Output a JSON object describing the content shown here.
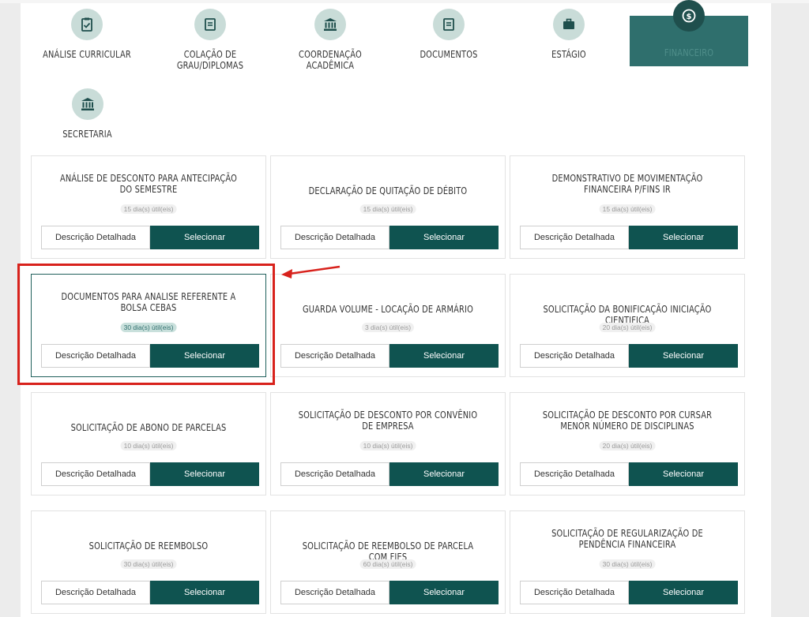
{
  "categories": [
    {
      "label": "ANÁLISE CURRICULAR",
      "icon": "clipboard-check-icon"
    },
    {
      "label": "COLAÇÃO DE\nGRAU/DIPLOMAS",
      "icon": "document-icon"
    },
    {
      "label": "COORDENAÇÃO\nACADÊMICA",
      "icon": "building-columns-icon"
    },
    {
      "label": "DOCUMENTOS",
      "icon": "document-icon"
    },
    {
      "label": "ESTÁGIO",
      "icon": "briefcase-icon"
    },
    {
      "label": "FINANCEIRO",
      "icon": "dollar-icon",
      "active": true
    },
    {
      "label": "SECRETARIA",
      "icon": "building-columns-icon"
    }
  ],
  "services": [
    {
      "title": "ANÁLISE DE DESCONTO PARA ANTECIPAÇÃO DO SEMESTRE",
      "deadline": "15 dia(s) útil(eis)"
    },
    {
      "title": "DECLARAÇÃO DE QUITAÇÃO DE DÉBITO",
      "deadline": "15 dia(s) útil(eis)"
    },
    {
      "title": "DEMONSTRATIVO DE MOVIMENTAÇÃO FINANCEIRA P/FINS IR",
      "deadline": "15 dia(s) útil(eis)"
    },
    {
      "title": "DOCUMENTOS PARA ANALISE REFERENTE A BOLSA CEBAS",
      "deadline": "30 dia(s) útil(eis)",
      "highlighted": true
    },
    {
      "title": "GUARDA VOLUME - LOCAÇÃO DE ARMÁRIO",
      "deadline": "3 dia(s) útil(eis)"
    },
    {
      "title": "SOLICITAÇÃO DA BONIFICAÇÃO INICIAÇÃO CIENTIFICA",
      "deadline": "20 dia(s) útil(eis)"
    },
    {
      "title": "SOLICITAÇÃO DE ABONO DE PARCELAS",
      "deadline": "10 dia(s) útil(eis)"
    },
    {
      "title": "SOLICITAÇÃO DE DESCONTO POR CONVÊNIO DE EMPRESA",
      "deadline": "10 dia(s) útil(eis)"
    },
    {
      "title": "SOLICITAÇÃO DE DESCONTO POR CURSAR MENOR NÚMERO DE DISCIPLINAS",
      "deadline": "20 dia(s) útil(eis)"
    },
    {
      "title": "SOLICITAÇÃO DE REEMBOLSO",
      "deadline": "30 dia(s) útil(eis)"
    },
    {
      "title": "SOLICITAÇÃO DE REEMBOLSO DE PARCELA COM FIES",
      "deadline": "60 dia(s) útil(eis)"
    },
    {
      "title": "SOLICITAÇÃO DE REGULARIZAÇÃO DE PENDÊNCIA FINANCEIRA",
      "deadline": "30 dia(s) útil(eis)"
    }
  ],
  "buttons": {
    "detail": "Descrição Detalhada",
    "select": "Selecionar"
  },
  "colors": {
    "accent": "#0f5350",
    "icon_bg": "#c9dcd8",
    "highlight": "#d8221c",
    "active_tab": "#2f6f6d"
  }
}
